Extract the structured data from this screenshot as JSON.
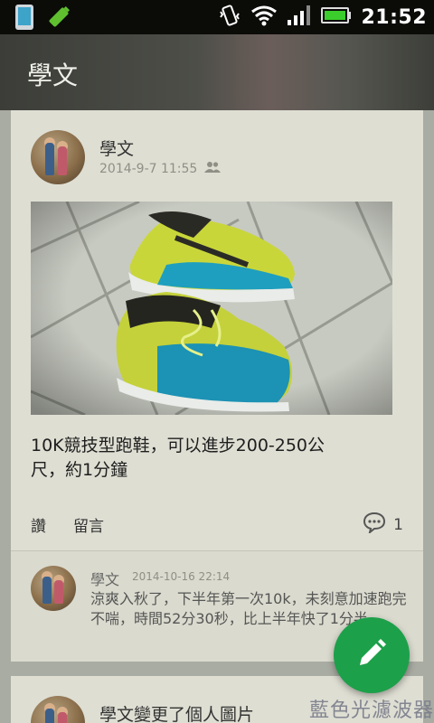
{
  "status_bar": {
    "time": "21:52",
    "icons": [
      "phone-icon",
      "battery-saver-icon",
      "vibrate-icon",
      "wifi-icon",
      "signal-icon",
      "battery-icon"
    ]
  },
  "app_bar": {
    "title": "學文"
  },
  "post": {
    "author": "學文",
    "timestamp": "2014-9-7 11:55",
    "audience_icon": "friends-icon",
    "photo_description_icon": "shoe-photo",
    "text": "10K競技型跑鞋，可以進步200-250公尺，約1分鐘",
    "like_label": "讚",
    "comment_label": "留言",
    "comment_count": "1"
  },
  "comment": {
    "author": "學文",
    "timestamp": "2014-10-16 22:14",
    "text": "涼爽入秋了，下半年第一次10k，未刻意加速跑完不喘，時間52分30秒，比上半年快了1分半。"
  },
  "next_post": {
    "text": "學文變更了個人圖片"
  },
  "fab": {
    "icon": "edit-pencil-icon"
  },
  "overlay": {
    "watermark": "藍色光濾波器"
  },
  "colors": {
    "fab": "#1da04a",
    "card": "#deded3",
    "background": "#a9aca3"
  }
}
